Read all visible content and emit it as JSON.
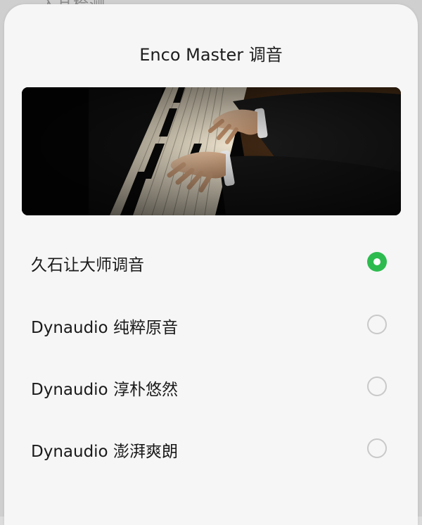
{
  "backdrop": {
    "peek_text": "入耳检测"
  },
  "dialog": {
    "title": "Enco Master 调音"
  },
  "hero_image": {
    "subject": "pianist hands on piano keys"
  },
  "options": [
    {
      "label": "久石让大师调音",
      "selected": true
    },
    {
      "label": "Dynaudio 纯粹原音",
      "selected": false
    },
    {
      "label": "Dynaudio 淳朴悠然",
      "selected": false
    },
    {
      "label": "Dynaudio 澎湃爽朗",
      "selected": false
    }
  ],
  "colors": {
    "accent": "#2dbb4f",
    "sheet_background": "#f6f6f6",
    "radio_unselected_border": "#c9c9c9"
  }
}
